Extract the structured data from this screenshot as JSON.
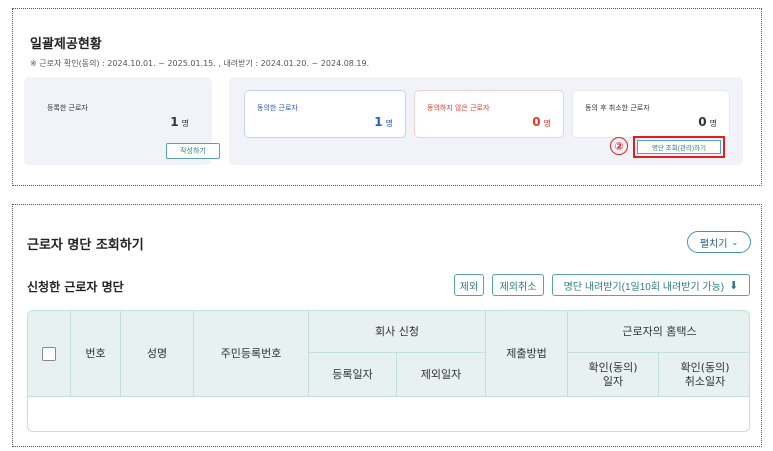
{
  "summary": {
    "title": "일괄제공현황",
    "period": "※ 근로자 확인(동의) : 2024.10.01. ~ 2025.01.15. , 내려받기 : 2024.01.20. ~ 2024.08.19.",
    "cards": {
      "registered": {
        "label": "등록한 근로자",
        "value": "1",
        "unit": "명"
      },
      "agreed": {
        "label": "동의한 근로자",
        "value": "1",
        "unit": "명"
      },
      "not_agreed": {
        "label": "동의하지 않은 근로자",
        "value": "0",
        "unit": "명"
      },
      "cancelled": {
        "label": "동의 후 취소한 근로자",
        "value": "0",
        "unit": "명"
      }
    },
    "write_button": "작성하기",
    "badge": "②",
    "view_button": "명단 조회(관리)하기"
  },
  "roster": {
    "title": "근로자 명단 조회하기",
    "expand_button": "펼치기",
    "subtitle": "신청한 근로자 명단",
    "buttons": {
      "exclude": "제외",
      "exclude_cancel": "제외취소",
      "download": "명단 내려받기(1일10회 내려받기 가능)"
    },
    "table": {
      "col_no": "번호",
      "col_name": "성명",
      "col_rrn": "주민등록번호",
      "group_company": "회사 신청",
      "col_reg_date": "등록일자",
      "col_excl_date": "제외일자",
      "col_method": "제출방법",
      "group_hometax": "근로자의 홈택스",
      "col_confirm_date": "확인(동의)\n일자",
      "col_cancel_date": "확인(동의)\n취소일자",
      "rows": []
    }
  },
  "colors": {
    "accent_teal": "#2e7d80",
    "agree_blue": "#2d57c9",
    "not_agree_red": "#e0392d",
    "highlight_red": "#e02020",
    "header_bg": "#e6f1f0"
  }
}
